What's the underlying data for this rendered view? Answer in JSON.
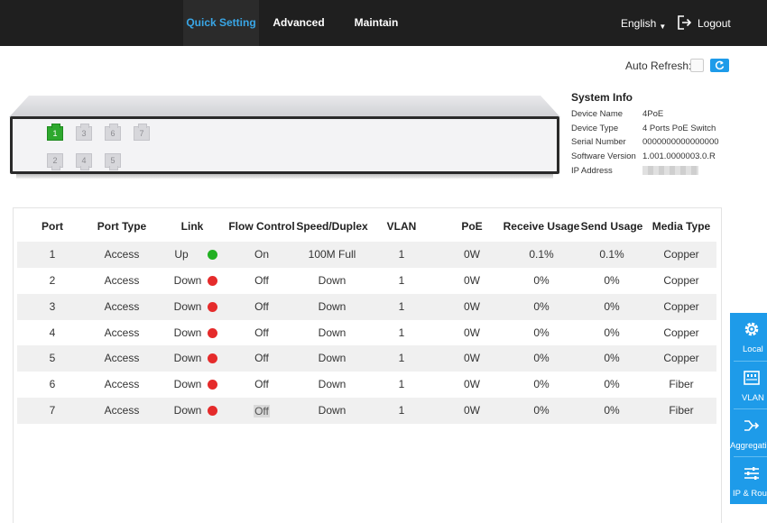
{
  "nav": {
    "tabs": [
      {
        "label": "Quick Setting",
        "active": true
      },
      {
        "label": "Advanced",
        "active": false
      },
      {
        "label": "Maintain",
        "active": false
      }
    ],
    "language": "English",
    "logout_label": "Logout"
  },
  "auto_refresh": {
    "label": "Auto Refresh:",
    "enabled": false
  },
  "switch_panel": {
    "ports": [
      {
        "number": "1",
        "status": "up"
      },
      {
        "number": "2",
        "status": "down"
      },
      {
        "number": "3",
        "status": "down"
      },
      {
        "number": "4",
        "status": "down"
      },
      {
        "number": "5",
        "status": "down"
      },
      {
        "number": "6",
        "status": "down"
      },
      {
        "number": "7",
        "status": "down"
      }
    ]
  },
  "system_info": {
    "title": "System Info",
    "rows": [
      {
        "key": "Device Name",
        "value": "4PoE"
      },
      {
        "key": "Device Type",
        "value": "4 Ports PoE Switch"
      },
      {
        "key": "Serial Number",
        "value": "0000000000000000"
      },
      {
        "key": "Software Version",
        "value": "1.001.0000003.0.R"
      },
      {
        "key": "IP Address",
        "value": ""
      }
    ]
  },
  "port_table": {
    "columns": [
      "Port",
      "Port Type",
      "Link",
      "Flow Control",
      "Speed/Duplex",
      "VLAN",
      "PoE",
      "Receive Usage",
      "Send Usage",
      "Media Type"
    ],
    "rows": [
      {
        "port": "1",
        "type": "Access",
        "link": "Up",
        "flow": "On",
        "speed": "100M Full",
        "vlan": "1",
        "poe": "0W",
        "recv": "0.1%",
        "send": "0.1%",
        "media": "Copper"
      },
      {
        "port": "2",
        "type": "Access",
        "link": "Down",
        "flow": "Off",
        "speed": "Down",
        "vlan": "1",
        "poe": "0W",
        "recv": "0%",
        "send": "0%",
        "media": "Copper"
      },
      {
        "port": "3",
        "type": "Access",
        "link": "Down",
        "flow": "Off",
        "speed": "Down",
        "vlan": "1",
        "poe": "0W",
        "recv": "0%",
        "send": "0%",
        "media": "Copper"
      },
      {
        "port": "4",
        "type": "Access",
        "link": "Down",
        "flow": "Off",
        "speed": "Down",
        "vlan": "1",
        "poe": "0W",
        "recv": "0%",
        "send": "0%",
        "media": "Copper"
      },
      {
        "port": "5",
        "type": "Access",
        "link": "Down",
        "flow": "Off",
        "speed": "Down",
        "vlan": "1",
        "poe": "0W",
        "recv": "0%",
        "send": "0%",
        "media": "Copper"
      },
      {
        "port": "6",
        "type": "Access",
        "link": "Down",
        "flow": "Off",
        "speed": "Down",
        "vlan": "1",
        "poe": "0W",
        "recv": "0%",
        "send": "0%",
        "media": "Fiber"
      },
      {
        "port": "7",
        "type": "Access",
        "link": "Down",
        "flow": "Off",
        "speed": "Down",
        "vlan": "1",
        "poe": "0W",
        "recv": "0%",
        "send": "0%",
        "media": "Fiber"
      }
    ]
  },
  "side_panel": {
    "items": [
      {
        "label": "Local",
        "icon": "gear-icon"
      },
      {
        "label": "VLAN",
        "icon": "vlan-icon"
      },
      {
        "label": "Aggregation",
        "icon": "aggregation-icon"
      },
      {
        "label": "IP & Route",
        "icon": "sliders-icon"
      }
    ]
  },
  "colors": {
    "accent": "#1e9be9",
    "active_tab": "#39a6e6",
    "link_up": "#22b022",
    "link_down": "#e52b2b",
    "port_up": "#2ea82e"
  }
}
